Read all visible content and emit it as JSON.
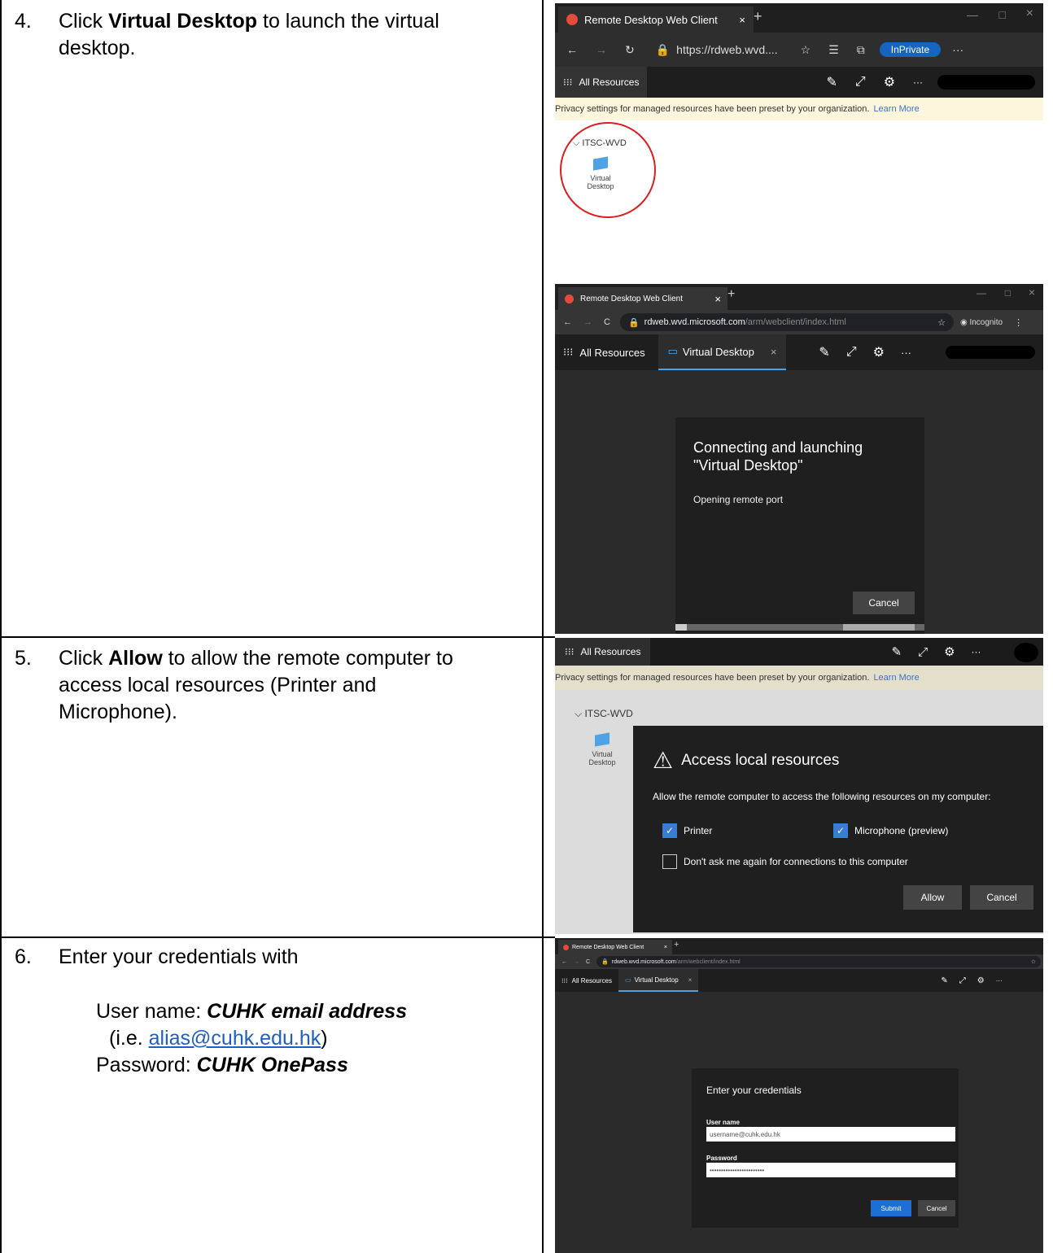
{
  "steps": [
    {
      "num": "4.",
      "pre": "Click ",
      "bold": "Virtual Desktop",
      "post_line1": " to launch the virtual",
      "line2": "desktop."
    },
    {
      "num": "5.",
      "pre": "Click ",
      "bold": "Allow",
      "post_line1": " to allow the remote computer to",
      "line2": "access local resources (Printer and",
      "line3": "Microphone)."
    },
    {
      "num": "6.",
      "text": "Enter your credentials with"
    }
  ],
  "credentials": {
    "user_label": "User name: ",
    "user_value": "CUHK email address",
    "ie_open": "(i.e. ",
    "ie_link": "alias@cuhk.edu.hk",
    "ie_close": ")",
    "pass_label": "Password: ",
    "pass_value": "CUHK OnePass"
  },
  "shot1": {
    "tab_title": "Remote Desktop Web Client",
    "url": "https://rdweb.wvd....",
    "inprivate": "InPrivate",
    "all_resources": "All Resources",
    "notice": "Privacy settings for managed resources have been preset by your organization.",
    "learn_more": "Learn More",
    "group": "ITSC-WVD",
    "resource_line1": "Virtual",
    "resource_line2": "Desktop"
  },
  "shot2": {
    "tab_title": "Remote Desktop Web Client",
    "url_host": "rdweb.wvd.microsoft.com",
    "url_path": "/arm/webclient/index.html",
    "incognito": "Incognito",
    "all_resources": "All Resources",
    "vd_tab": "Virtual Desktop",
    "dialog_title_1": "Connecting and launching",
    "dialog_title_2": "\"Virtual Desktop\"",
    "status": "Opening remote port",
    "cancel": "Cancel"
  },
  "shot3": {
    "all_resources": "All Resources",
    "notice": "Privacy settings for managed resources have been preset by your organization.",
    "learn_more": "Learn More",
    "group": "ITSC-WVD",
    "resource_line1": "Virtual",
    "resource_line2": "Desktop",
    "dialog_title": "Access local resources",
    "dialog_desc": "Allow the remote computer to access the following resources on my computer:",
    "printer": "Printer",
    "microphone": "Microphone (preview)",
    "dont_ask": "Don't ask me again for connections to this computer",
    "allow": "Allow",
    "cancel": "Cancel"
  },
  "shot4": {
    "tab_title": "Remote Desktop Web Client",
    "url_host": "rdweb.wvd.microsoft.com",
    "url_path": "/arm/webclient/index.html",
    "all_resources": "All Resources",
    "vd_tab": "Virtual Desktop",
    "dialog_title": "Enter your credentials",
    "user_label": "User name",
    "user_value": "username@cuhk.edu.hk",
    "pass_label": "Password",
    "pass_value": "••••••••••••••••••••••••",
    "submit": "Submit",
    "cancel": "Cancel"
  }
}
